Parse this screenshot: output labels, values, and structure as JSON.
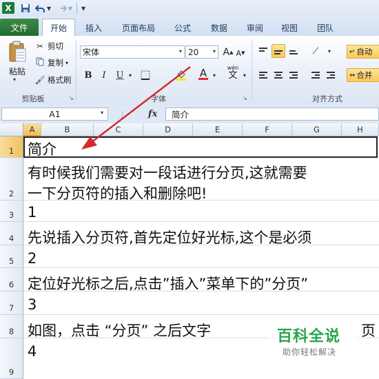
{
  "qat": {
    "app_icon": "X",
    "save_icon": "save-icon",
    "undo_icon": "undo-icon",
    "redo_icon": "redo-icon"
  },
  "tabs": {
    "file": "文件",
    "items": [
      "开始",
      "插入",
      "页面布局",
      "公式",
      "数据",
      "审阅",
      "视图",
      "团队"
    ],
    "active": "开始"
  },
  "ribbon": {
    "clipboard": {
      "paste": "粘贴",
      "cut": "剪切",
      "copy": "复制",
      "format_painter": "格式刷",
      "group_label": "剪贴板"
    },
    "font": {
      "name": "宋体",
      "size": "20",
      "grow": "A",
      "shrink": "A",
      "bold": "B",
      "italic": "I",
      "underline": "U",
      "font_color_letter": "A",
      "wen_label": "wén",
      "wen_char": "文",
      "group_label": "字体"
    },
    "alignment": {
      "wrap_text": "自动",
      "merge": "合并",
      "group_label": "对齐方式"
    }
  },
  "formula_bar": {
    "name_box": "A1",
    "fx": "fx",
    "content": "简介"
  },
  "grid": {
    "columns": [
      "A",
      "B",
      "C",
      "D",
      "E",
      "F",
      "G",
      "H"
    ],
    "selected_column": "A",
    "rows": [
      {
        "num": "1",
        "text": "简介"
      },
      {
        "num": "2",
        "text": "有时候我们需要对一段话进行分页,这就需要",
        "text2": "一下分页符的插入和删除吧!"
      },
      {
        "num": "3",
        "text": "1"
      },
      {
        "num": "4",
        "text": "先说插入分页符,首先定位好光标,这个是必须"
      },
      {
        "num": "5",
        "text": "2"
      },
      {
        "num": "6",
        "text": "定位好光标之后,点击”插入”菜单下的”分页”"
      },
      {
        "num": "7",
        "text": "3"
      },
      {
        "num": "8",
        "text": "如图，点击 “分页” 之后文字",
        "text_tail": "页"
      },
      {
        "num": "9",
        "text": "4"
      }
    ]
  },
  "watermark": {
    "title": "百科全说",
    "subtitle": "助你轻松解决"
  },
  "colors": {
    "file_tab": "#2a7d37",
    "arrow": "#d42a2a",
    "watermark": "#2aa54a",
    "selection_header": "#f1c15f"
  }
}
